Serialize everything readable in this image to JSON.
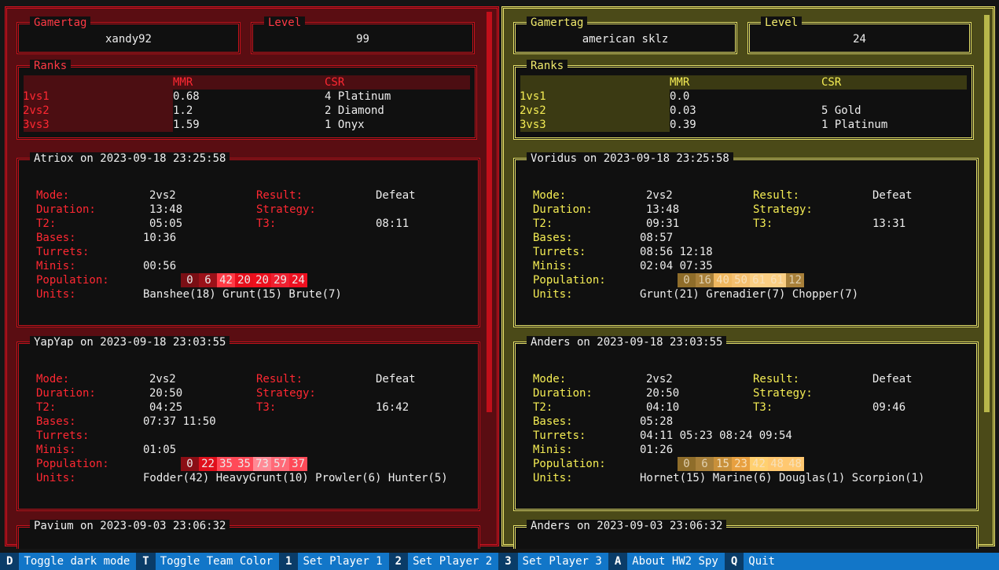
{
  "player1": {
    "gamertag_label": "Gamertag",
    "gamertag": "xandy92",
    "level_label": "Level",
    "level": "99",
    "ranks_label": "Ranks",
    "ranks_header": {
      "mmr": "MMR",
      "csr": "CSR"
    },
    "ranks": [
      {
        "mode": "1vs1",
        "mmr": "0.68",
        "csr": "4 Platinum"
      },
      {
        "mode": "2vs2",
        "mmr": "1.2",
        "csr": "2 Diamond"
      },
      {
        "mode": "3vs3",
        "mmr": "1.59",
        "csr": "1 Onyx"
      }
    ],
    "matches": [
      {
        "title": "Atriox on 2023-09-18 23:25:58",
        "mode": "2vs2",
        "result": "Defeat",
        "duration": "13:48",
        "strategy": "",
        "t2": "05:05",
        "t3": "08:11",
        "bases": "10:36",
        "turrets": "",
        "minis": "00:56",
        "population": [
          "0",
          "6",
          "42",
          "20",
          "20",
          "29",
          "24"
        ],
        "units": "Banshee(18) Grunt(15) Brute(7)"
      },
      {
        "title": "YapYap on 2023-09-18 23:03:55",
        "mode": "2vs2",
        "result": "Defeat",
        "duration": "20:50",
        "strategy": "",
        "t2": "04:25",
        "t3": "16:42",
        "bases": "07:37 11:50",
        "turrets": "",
        "minis": "01:05",
        "population": [
          "0",
          "22",
          "35",
          "35",
          "73",
          "57",
          "37"
        ],
        "units": "Fodder(42) HeavyGrunt(10) Prowler(6) Hunter(5)"
      },
      {
        "title": "Pavium on 2023-09-03 23:06:32"
      }
    ]
  },
  "player2": {
    "gamertag_label": "Gamertag",
    "gamertag": "american sklz",
    "level_label": "Level",
    "level": "24",
    "ranks_label": "Ranks",
    "ranks_header": {
      "mmr": "MMR",
      "csr": "CSR"
    },
    "ranks": [
      {
        "mode": "1vs1",
        "mmr": "0.0",
        "csr": ""
      },
      {
        "mode": "2vs2",
        "mmr": "0.03",
        "csr": "5 Gold"
      },
      {
        "mode": "3vs3",
        "mmr": "0.39",
        "csr": "1 Platinum"
      }
    ],
    "matches": [
      {
        "title": "Voridus on 2023-09-18 23:25:58",
        "mode": "2vs2",
        "result": "Defeat",
        "duration": "13:48",
        "strategy": "",
        "t2": "09:31",
        "t3": "13:31",
        "bases": "08:57",
        "turrets": "08:56 12:18",
        "minis": "02:04 07:35",
        "population": [
          "0",
          "16",
          "40",
          "50",
          "61",
          "61",
          "12"
        ],
        "units": "Grunt(21) Grenadier(7) Chopper(7)"
      },
      {
        "title": "Anders on 2023-09-18 23:03:55",
        "mode": "2vs2",
        "result": "Defeat",
        "duration": "20:50",
        "strategy": "",
        "t2": "04:10",
        "t3": "09:46",
        "bases": "05:28",
        "turrets": "04:11 05:23 08:24 09:54",
        "minis": "01:26",
        "population": [
          "0",
          "6",
          "15",
          "23",
          "42",
          "48",
          "48"
        ],
        "units": "Hornet(15) Marine(6) Douglas(1) Scorpion(1)"
      },
      {
        "title": "Anders on 2023-09-03 23:06:32"
      }
    ]
  },
  "labels": {
    "mode": "Mode:",
    "duration": "Duration:",
    "t2": "T2:",
    "bases": "Bases:",
    "turrets": "Turrets:",
    "minis": "Minis:",
    "population": "Population:",
    "units": "Units:",
    "result": "Result:",
    "strategy": "Strategy:",
    "t3": "T3:"
  },
  "footer": [
    {
      "key": "D",
      "label": "Toggle dark mode"
    },
    {
      "key": "T",
      "label": "Toggle Team Color"
    },
    {
      "key": "1",
      "label": "Set Player 1"
    },
    {
      "key": "2",
      "label": "Set Player 2"
    },
    {
      "key": "3",
      "label": "Set Player 3"
    },
    {
      "key": "A",
      "label": "About HW2 Spy"
    },
    {
      "key": "Q",
      "label": "Quit"
    }
  ],
  "colors": {
    "team1_accent": "#d0121f",
    "team2_accent": "#ece46e",
    "footer_bg": "#1276c8",
    "pop_red": [
      "#7a0f15",
      "#9a1119",
      "#ff3a45",
      "#e60f1c",
      "#ee0f1d",
      "#ee2030",
      "#ee1020"
    ],
    "pop_red2": [
      "#8a0e15",
      "#e0101c",
      "#ff4a58",
      "#ff4a58",
      "#ff8a95",
      "#ff6a78",
      "#ff4a58"
    ],
    "pop_yel": [
      "#8f6d2a",
      "#a8803a",
      "#f0b860",
      "#f5c070",
      "#fbcf84",
      "#fbcf84",
      "#a8803a"
    ],
    "pop_yel2": [
      "#8f6d2a",
      "#a8803a",
      "#c8903a",
      "#e8a040",
      "#ffd070",
      "#ffc870",
      "#ffc870"
    ]
  }
}
